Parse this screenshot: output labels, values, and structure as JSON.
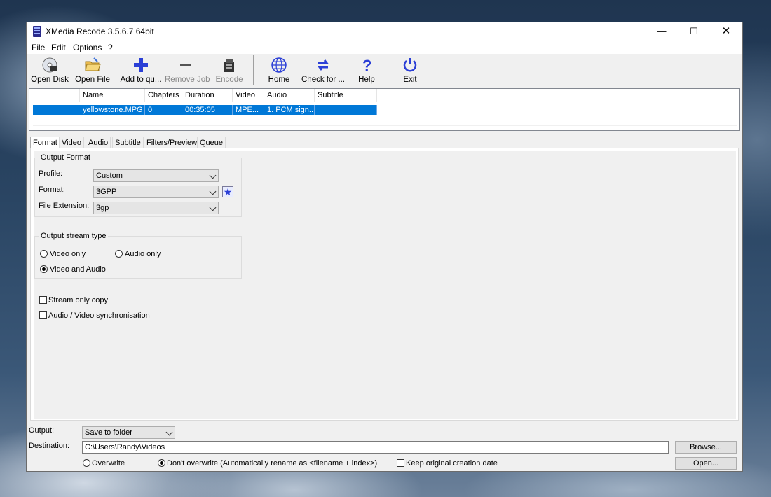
{
  "window": {
    "title": "XMedia Recode 3.5.6.7 64bit"
  },
  "menu": [
    "File",
    "Edit",
    "Options",
    "?"
  ],
  "toolbar": {
    "open_disk": "Open Disk",
    "open_file": "Open File",
    "add_to_queue": "Add to qu...",
    "remove_job": "Remove Job",
    "encode": "Encode",
    "home": "Home",
    "check_for_updates": "Check for ...",
    "help": "Help",
    "exit": "Exit"
  },
  "file_list": {
    "columns": [
      "Name",
      "Chapters",
      "Duration",
      "Video",
      "Audio",
      "Subtitle"
    ],
    "rows": [
      {
        "name": "yellowstone.MPG",
        "chapters": "0",
        "duration": "00:35:05",
        "video": "MPE...",
        "audio": "1. PCM sign...",
        "subtitle": ""
      }
    ]
  },
  "tabs": [
    "Format",
    "Video",
    "Audio",
    "Subtitle",
    "Filters/Preview",
    "Queue"
  ],
  "format_tab": {
    "output_format_title": "Output Format",
    "profile_label": "Profile:",
    "profile_value": "Custom",
    "format_label": "Format:",
    "format_value": "3GPP",
    "extension_label": "File Extension:",
    "extension_value": "3gp",
    "stream_type_title": "Output stream type",
    "video_only": "Video only",
    "audio_only": "Audio only",
    "video_and_audio": "Video and Audio",
    "stream_only_copy": "Stream only copy",
    "av_sync": "Audio / Video synchronisation"
  },
  "bottom": {
    "output_label": "Output:",
    "output_value": "Save to folder",
    "destination_label": "Destination:",
    "destination_value": "C:\\Users\\Randy\\Videos",
    "browse": "Browse...",
    "open": "Open...",
    "overwrite": "Overwrite",
    "dont_overwrite": "Don't overwrite (Automatically rename as <filename + index>)",
    "keep_date": "Keep original creation date"
  },
  "colors": {
    "selection": "#0078d7",
    "accent_blue": "#2b3fd6"
  }
}
